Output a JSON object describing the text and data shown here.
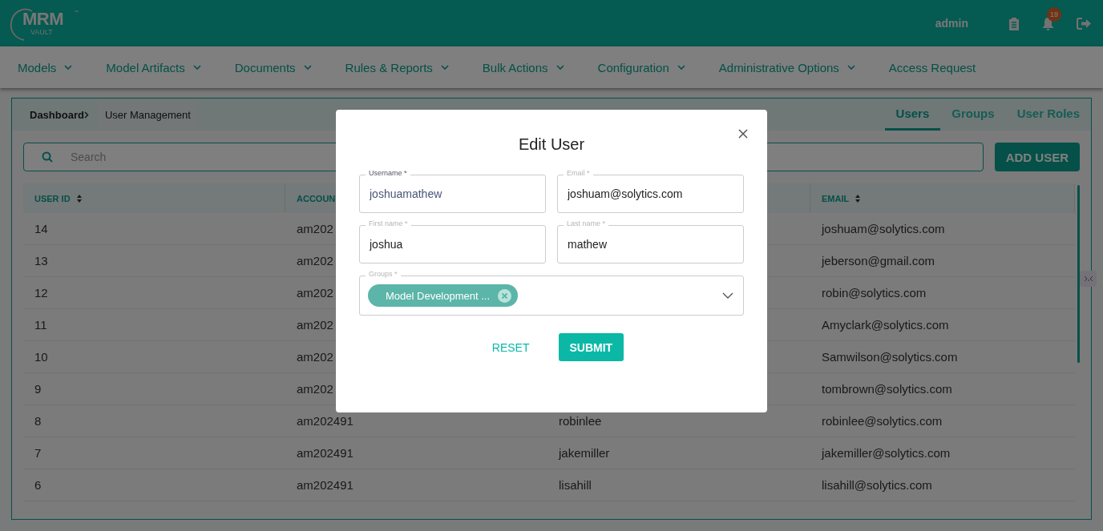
{
  "header": {
    "logo": {
      "name": "MRM",
      "sub": "VAULT",
      "mark": "™"
    },
    "user": "admin",
    "notifications": "19"
  },
  "nav": [
    {
      "label": "Models",
      "has_menu": true
    },
    {
      "label": "Model Artifacts",
      "has_menu": true
    },
    {
      "label": "Documents",
      "has_menu": true
    },
    {
      "label": "Rules & Reports",
      "has_menu": true
    },
    {
      "label": "Bulk Actions",
      "has_menu": true
    },
    {
      "label": "Configuration",
      "has_menu": true
    },
    {
      "label": "Administrative Options",
      "has_menu": true
    },
    {
      "label": "Access Request",
      "has_menu": false
    }
  ],
  "breadcrumb": [
    "Dashboard",
    "User Management"
  ],
  "tabs": [
    {
      "label": "Users",
      "selected": true
    },
    {
      "label": "Groups",
      "selected": false
    },
    {
      "label": "User Roles",
      "selected": false
    }
  ],
  "search": {
    "placeholder": "Search"
  },
  "add_button": "ADD USER",
  "table": {
    "columns": [
      {
        "label": "USER ID",
        "sort_icon": true
      },
      {
        "label": "ACCOUN"
      },
      null,
      {
        "label": "EMAIL",
        "sort_icon": true
      }
    ],
    "rows": [
      [
        "14",
        "am202",
        null,
        "joshuam@solytics.com"
      ],
      [
        "13",
        "am202",
        null,
        "jeberson@gmail.com"
      ],
      [
        "12",
        "am202",
        null,
        "robin@solytics.com"
      ],
      [
        "11",
        "am202",
        null,
        "Amyclark@solytics.com"
      ],
      [
        "10",
        "am202",
        null,
        "Samwilson@solytics.com"
      ],
      [
        "9",
        "am202",
        null,
        "tombrown@solytics.com"
      ],
      [
        "8",
        "am202491",
        "robinlee",
        "robinlee@solytics.com"
      ],
      [
        "7",
        "am202491",
        "jakemiller",
        "jakemiller@solytics.com"
      ],
      [
        "6",
        "am202491",
        "lisahill",
        "lisahill@solytics.com"
      ]
    ]
  },
  "dialog": {
    "title": "Edit User",
    "fields": [
      {
        "label": "Username *",
        "value": "joshuamathew",
        "focused": true
      },
      {
        "label": "Email *",
        "value": "joshuam@solytics.com",
        "focused": false
      },
      {
        "label": "First name *",
        "value": "joshua",
        "focused": false
      },
      {
        "label": "Last name *",
        "value": "mathew",
        "focused": false
      }
    ],
    "groups": {
      "label": "Groups *",
      "chips": [
        "Model Development ..."
      ]
    },
    "buttons": {
      "reset": "RESET",
      "submit": "SUBMIT"
    }
  }
}
